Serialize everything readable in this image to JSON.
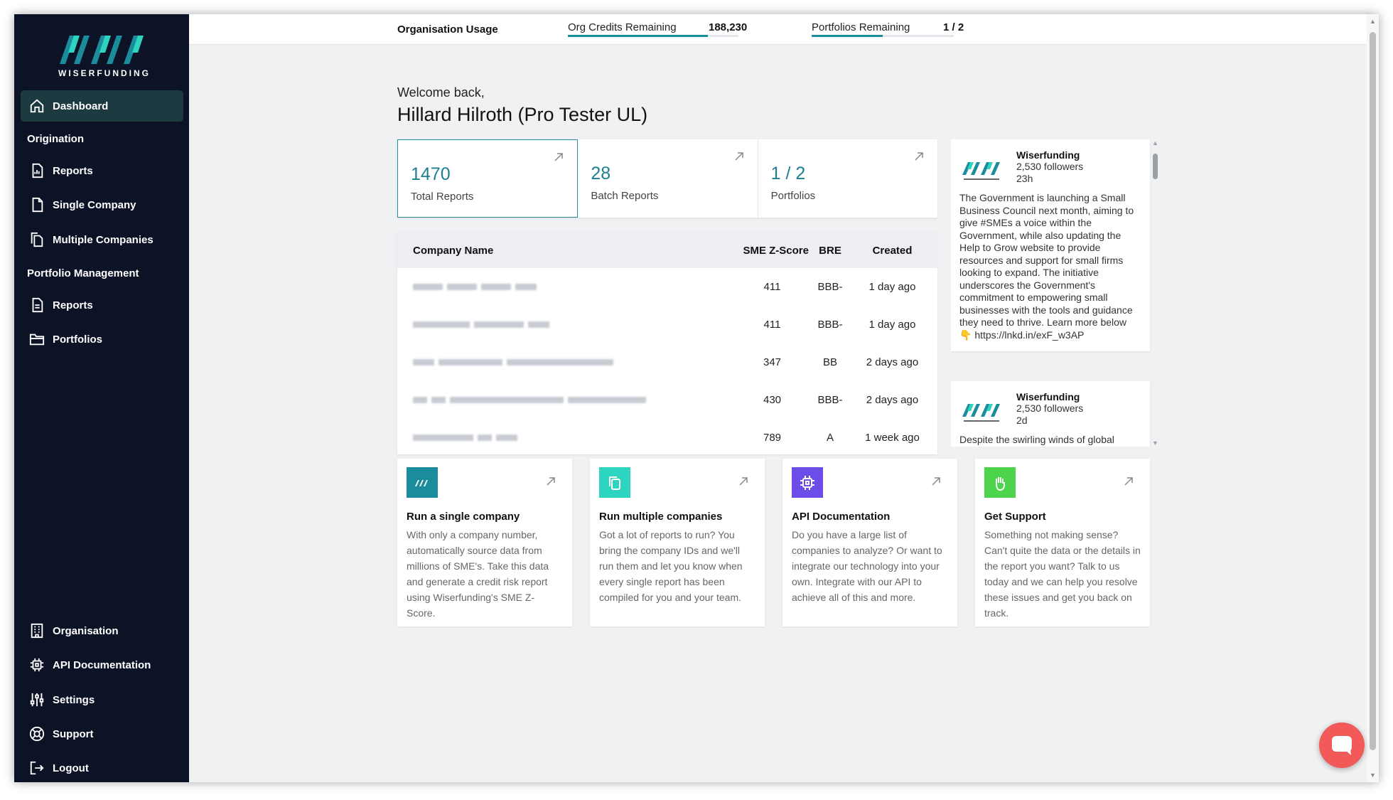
{
  "brand": {
    "name": "WISERFUNDING",
    "accent": "#1e7f91",
    "sidebar_bg": "#0d1326"
  },
  "topbar": {
    "title": "Organisation Usage",
    "credits_label": "Org Credits Remaining",
    "credits_value": "188,230",
    "credits_fill": 0.82,
    "portfolios_label": "Portfolios Remaining",
    "portfolios_value": "1 / 2",
    "portfolios_fill": 0.5
  },
  "sidebar": {
    "dashboard": "Dashboard",
    "section_origination": "Origination",
    "reports_origination": "Reports",
    "single_company": "Single Company",
    "multiple_companies": "Multiple Companies",
    "section_portfolio": "Portfolio Management",
    "reports_portfolio": "Reports",
    "portfolios": "Portfolios",
    "organisation": "Organisation",
    "api_documentation": "API Documentation",
    "settings": "Settings",
    "support": "Support",
    "logout": "Logout"
  },
  "welcome": {
    "greeting": "Welcome back,",
    "name": "Hillard Hilroth (Pro Tester UL)"
  },
  "stats": [
    {
      "value": "1470",
      "label": "Total Reports"
    },
    {
      "value": "28",
      "label": "Batch Reports"
    },
    {
      "value": "1 / 2",
      "label": "Portfolios"
    }
  ],
  "table": {
    "headers": {
      "name": "Company Name",
      "score": "SME Z-Score",
      "bre": "BRE",
      "created": "Created"
    },
    "rows": [
      {
        "score": "411",
        "bre": "BBB-",
        "created": "1 day ago"
      },
      {
        "score": "411",
        "bre": "BBB-",
        "created": "1 day ago"
      },
      {
        "score": "347",
        "bre": "BB",
        "created": "2 days ago"
      },
      {
        "score": "430",
        "bre": "BBB-",
        "created": "2 days ago"
      },
      {
        "score": "789",
        "bre": "A",
        "created": "1 week ago"
      }
    ]
  },
  "feed": [
    {
      "author": "Wiserfunding",
      "followers": "2,530 followers",
      "time": "23h",
      "text": "The Government is launching a Small Business Council next month, aiming to give #SMEs a voice within the Government, while also updating the Help to Grow website to provide resources and support for small firms looking to expand. The initiative underscores the Government's commitment to empowering small businesses with the tools and guidance they need to thrive. Learn more below 👇 https://lnkd.in/exF_w3AP"
    },
    {
      "author": "Wiserfunding",
      "followers": "2,530 followers",
      "time": "2d",
      "text": "Despite the swirling winds of global"
    }
  ],
  "cards": [
    {
      "title": "Run a single company",
      "desc": "With only a company number, automatically source data from millions of SME's. Take this data and generate a credit risk report using Wiserfunding's SME Z-Score.",
      "color": "#1a8c9c",
      "icon": "wiserfunding-icon"
    },
    {
      "title": "Run multiple companies",
      "desc": "Got a lot of reports to run? You bring the company IDs and we'll run them and let you know when every single report has been compiled for you and your team.",
      "color": "#2dd4bf",
      "icon": "copy-icon"
    },
    {
      "title": "API Documentation",
      "desc": "Do you have a large list of companies to analyze? Or want to integrate our technology into your own. Integrate with our API to achieve all of this and more.",
      "color": "#6d4de8",
      "icon": "chip-icon"
    },
    {
      "title": "Get Support",
      "desc": "Something not making sense? Can't quite the data or the details in the report you want? Talk to us today and we can help you resolve these issues and get you back on track.",
      "color": "#4cd44c",
      "icon": "hand-icon"
    }
  ]
}
